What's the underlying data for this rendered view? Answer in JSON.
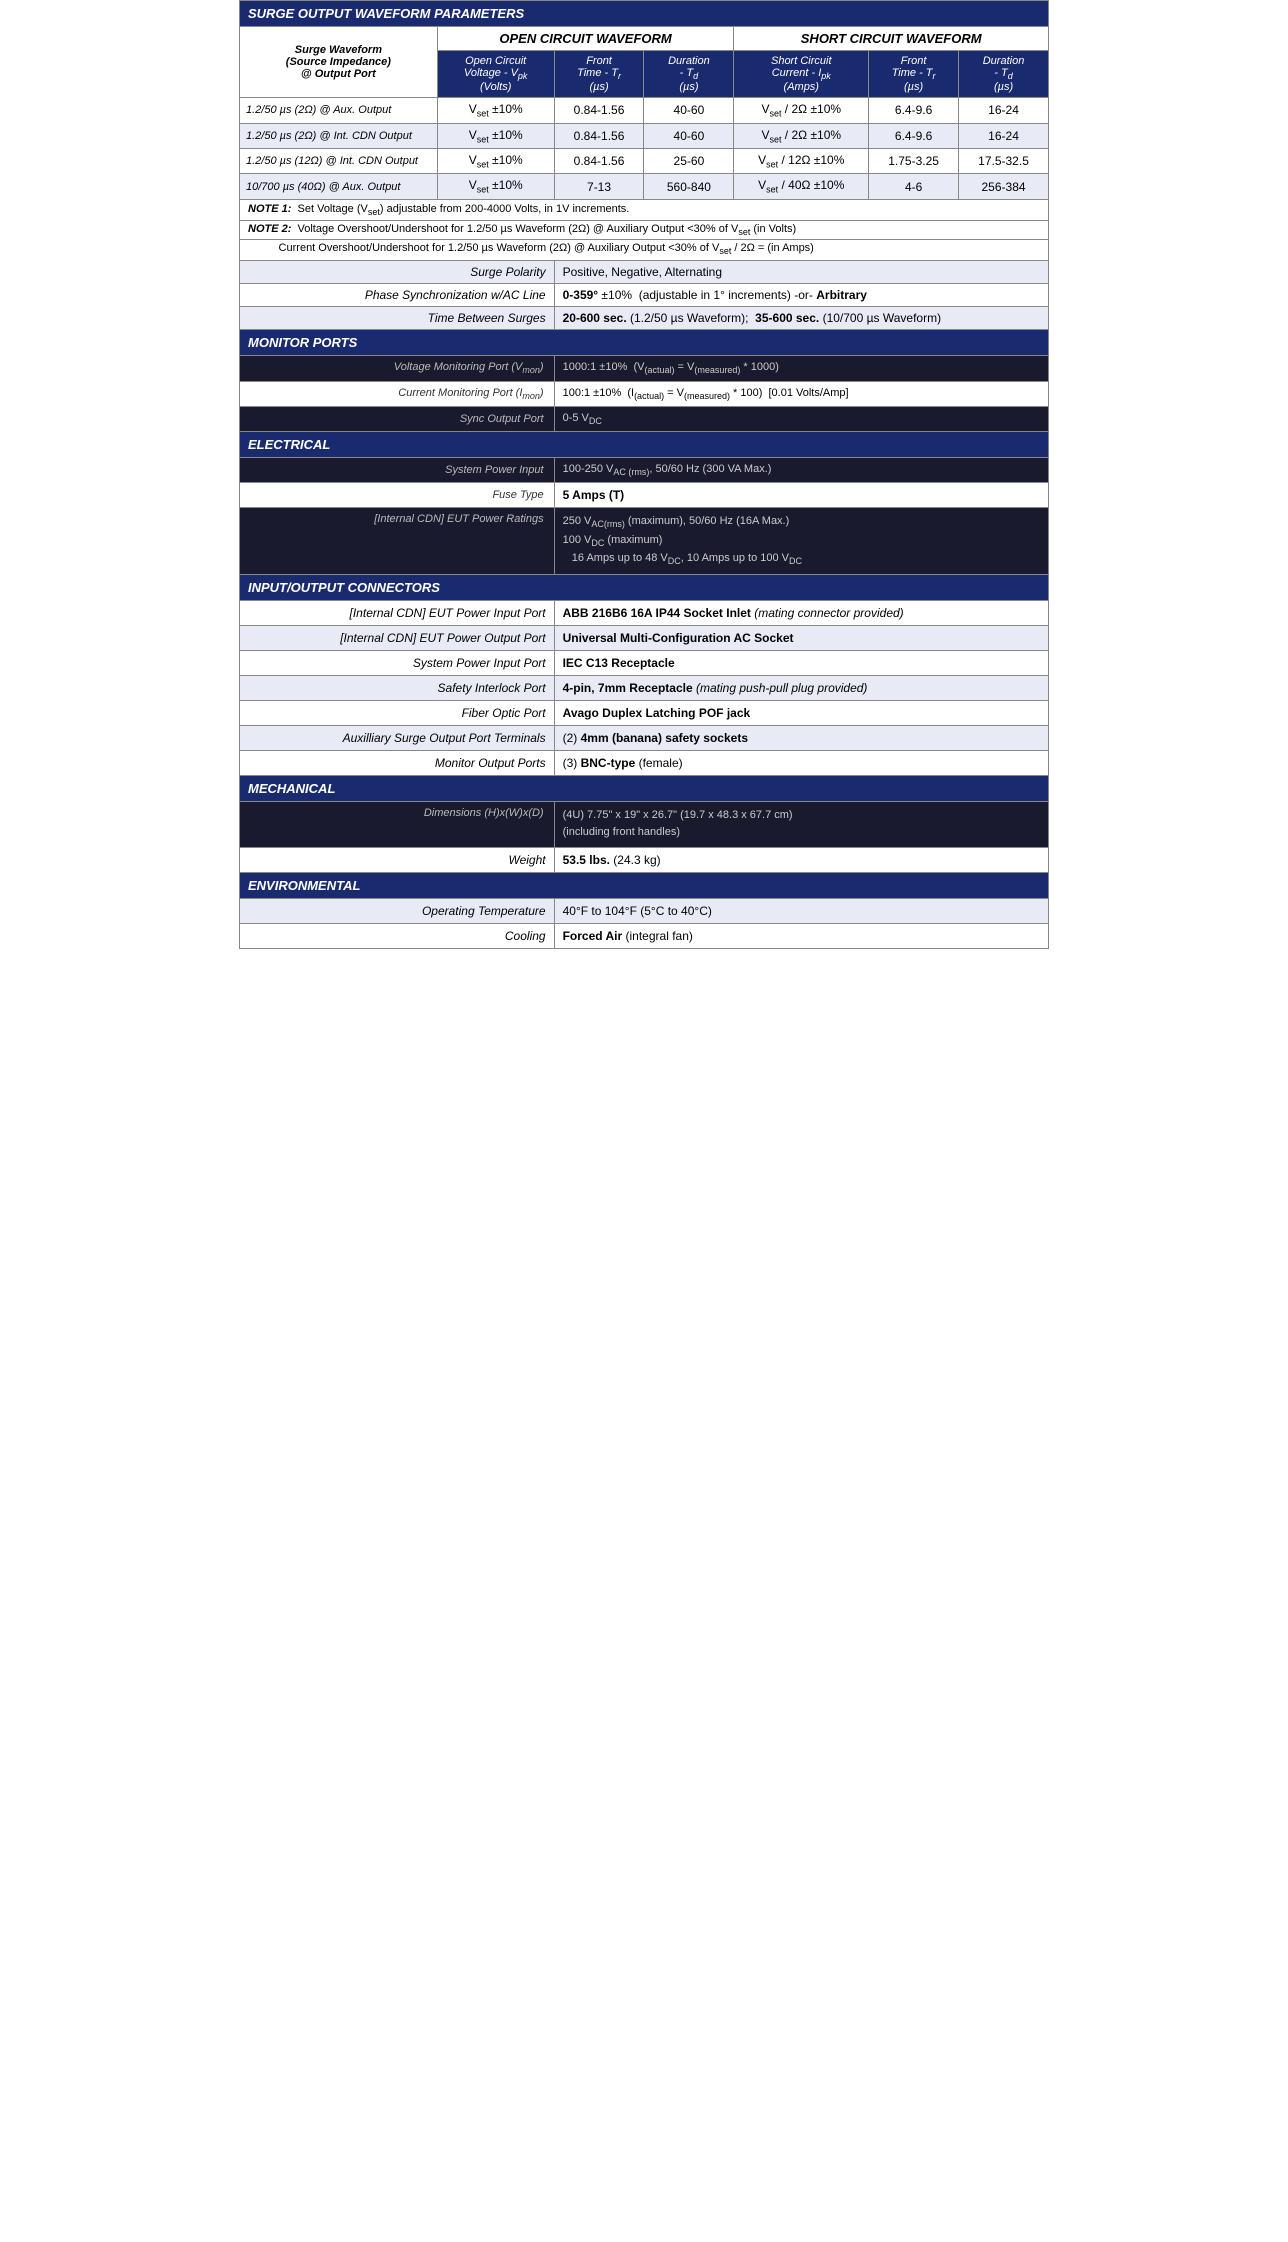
{
  "title": "SURGE OUTPUT WAVEFORM PARAMETERS",
  "waveform_table": {
    "col1_header": "Surge Waveform\n(Source Impedance)\n@ Output Port",
    "open_circuit_label": "OPEN CIRCUIT WAVEFORM",
    "short_circuit_label": "SHORT CIRCUIT WAVEFORM",
    "open_cols": [
      "Open Circuit\nVoltage - V_pk\n(Volts)",
      "Front\nTime - T_r\n(µs)",
      "Duration\n- T_d\n(µs)"
    ],
    "short_cols": [
      "Short Circuit\nCurrent - I_pk\n(Amps)",
      "Front\nTime - T_r\n(µs)",
      "Duration\n- T_d\n(µs)"
    ],
    "rows": [
      {
        "label": "1.2/50 µs (2Ω) @ Aux. Output",
        "oc_voltage": "V_set ±10%",
        "oc_front": "0.84-1.56",
        "oc_duration": "40-60",
        "sc_current": "V_set / 2Ω ±10%",
        "sc_front": "6.4-9.6",
        "sc_duration": "16-24"
      },
      {
        "label": "1.2/50 µs (2Ω) @ Int. CDN Output",
        "oc_voltage": "V_set ±10%",
        "oc_front": "0.84-1.56",
        "oc_duration": "40-60",
        "sc_current": "V_set / 2Ω ±10%",
        "sc_front": "6.4-9.6",
        "sc_duration": "16-24"
      },
      {
        "label": "1.2/50 µs (12Ω) @ Int. CDN Output",
        "oc_voltage": "V_set ±10%",
        "oc_front": "0.84-1.56",
        "oc_duration": "25-60",
        "sc_current": "V_set / 12Ω ±10%",
        "sc_front": "1.75-3.25",
        "sc_duration": "17.5-32.5"
      },
      {
        "label": "10/700 µs (40Ω) @ Aux. Output",
        "oc_voltage": "V_set ±10%",
        "oc_front": "7-13",
        "oc_duration": "560-840",
        "sc_current": "V_set / 40Ω ±10%",
        "sc_front": "4-6",
        "sc_duration": "256-384"
      }
    ],
    "notes": [
      "NOTE 1:  Set Voltage (V_set) adjustable from 200-4000 Volts, in 1V increments.",
      "NOTE 2:  Voltage Overshoot/Undershoot for 1.2/50 µs Waveform (2Ω) @ Auxiliary Output <30% of V_set (in Volts)",
      "         Current Overshoot/Undershoot for 1.2/50 µs Waveform (2Ω) @ Auxiliary Output <30% of V_set / 2Ω = (in Amps)"
    ]
  },
  "surge_params": [
    {
      "label": "Surge Polarity",
      "value": "Positive, Negative, Alternating"
    },
    {
      "label": "Phase Synchronization w/AC Line",
      "value": "0-359° ±10%  (adjustable in 1° increments) -or-  Arbitrary"
    },
    {
      "label": "Time Between Surges",
      "value": "20-600 sec. (1.2/50 µs Waveform);  35-600 sec. (10/700 µs Waveform)"
    }
  ],
  "monitor_section": {
    "title": "MONITOR PORTS",
    "rows": [
      {
        "label": "Voltage Monitoring Port (V_mon)",
        "value": "1000:1 ±10%  (V_(actual) = V_(measured) * 1000)",
        "dark": true
      },
      {
        "label": "Current Monitoring Port (I_mon)",
        "value": "100:1 ±10%  (I_(actual) = V_(measured) * 100)  [0.01 Volts/Amp]",
        "dark": false
      },
      {
        "label": "Sync Output Port",
        "value": "0-5 V_DC",
        "dark": true
      }
    ]
  },
  "electrical_section": {
    "title": "ELECTRICAL",
    "rows": [
      {
        "label": "System Power Input",
        "value": "100-250 V_AC(rms), 50/60 Hz (300 VA Max.)",
        "dark": true
      },
      {
        "label": "Fuse Type",
        "value": "5 Amps (T)",
        "dark": false
      },
      {
        "label": "[Internal CDN] EUT Power Ratings",
        "value": "250 V_AC(rms) (maximum), 50/60 Hz (16A Max.)\n100 V_DC (maximum)\n   16 Amps up to 48 V_DC, 10 Amps up to 100 V_DC",
        "dark": true
      }
    ]
  },
  "io_section": {
    "title": "INPUT/OUTPUT CONNECTORS",
    "rows": [
      {
        "label": "[Internal CDN] EUT Power Input Port",
        "value": "ABB 216B6 16A IP44 Socket Inlet (mating connector provided)",
        "dark": false
      },
      {
        "label": "[Internal CDN] EUT Power Output Port",
        "value": "Universal Multi-Configuration AC Socket",
        "dark": false
      },
      {
        "label": "System Power Input Port",
        "value": "IEC C13 Receptacle",
        "dark": false
      },
      {
        "label": "Safety Interlock Port",
        "value": "4-pin, 7mm Receptacle (mating push-pull plug provided)",
        "dark": false
      },
      {
        "label": "Fiber Optic Port",
        "value": "Avago Duplex Latching POF jack",
        "dark": false
      },
      {
        "label": "Auxilliary Surge Output Port Terminals",
        "value": "(2) 4mm (banana) safety sockets",
        "dark": false
      },
      {
        "label": "Monitor Output Ports",
        "value": "(3) BNC-type (female)",
        "dark": false
      }
    ]
  },
  "mechanical_section": {
    "title": "MECHANICAL",
    "rows": [
      {
        "label": "Dimensions (H)x(W)x(D)",
        "value": "(4U) 7.75\" x 19\" x 26.7\" (19.7 x 48.3 x 67.7 cm)\n(including front handles)",
        "dark": true
      },
      {
        "label": "Weight",
        "value": "53.5 lbs. (24.3 kg)",
        "dark": false
      }
    ]
  },
  "environmental_section": {
    "title": "ENVIRONMENTAL",
    "rows": [
      {
        "label": "Operating Temperature",
        "value": "40°F to 104°F (5°C to 40°C)",
        "dark": false
      },
      {
        "label": "Cooling",
        "value": "Forced Air (integral fan)",
        "dark": false
      }
    ]
  }
}
